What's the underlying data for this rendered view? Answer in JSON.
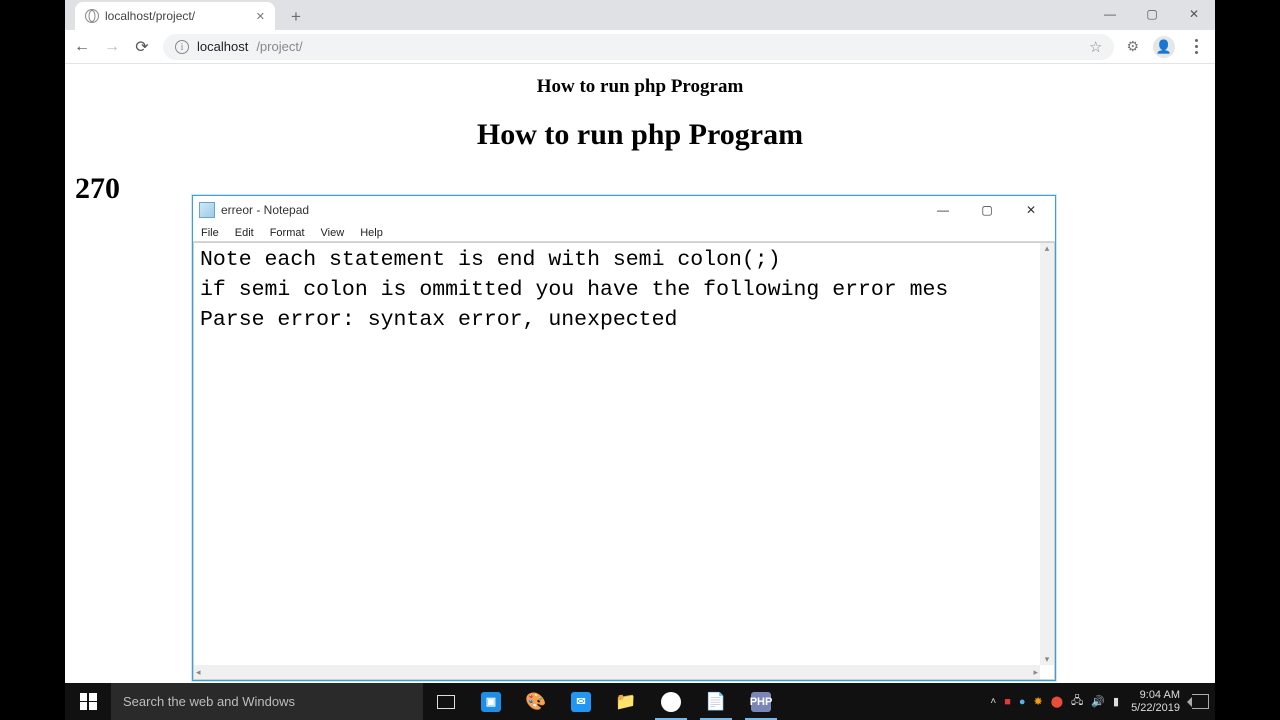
{
  "browser": {
    "tab_title": "localhost/project/",
    "url_host": "localhost",
    "url_path": "/project/"
  },
  "page": {
    "title_small": "How to run php Program",
    "title_large": "How to run php Program",
    "number": "270"
  },
  "notepad": {
    "title": "erreor - Notepad",
    "menu": {
      "file": "File",
      "edit": "Edit",
      "format": "Format",
      "view": "View",
      "help": "Help"
    },
    "line1": "Note each statement is end with semi colon(;)",
    "line2": "if semi colon is ommitted you have the following error mes",
    "line3": "Parse error: syntax error, unexpected"
  },
  "taskbar": {
    "search_placeholder": "Search the web and Windows",
    "php_label": "PHP",
    "time": "9:04 AM",
    "date": "5/22/2019"
  }
}
